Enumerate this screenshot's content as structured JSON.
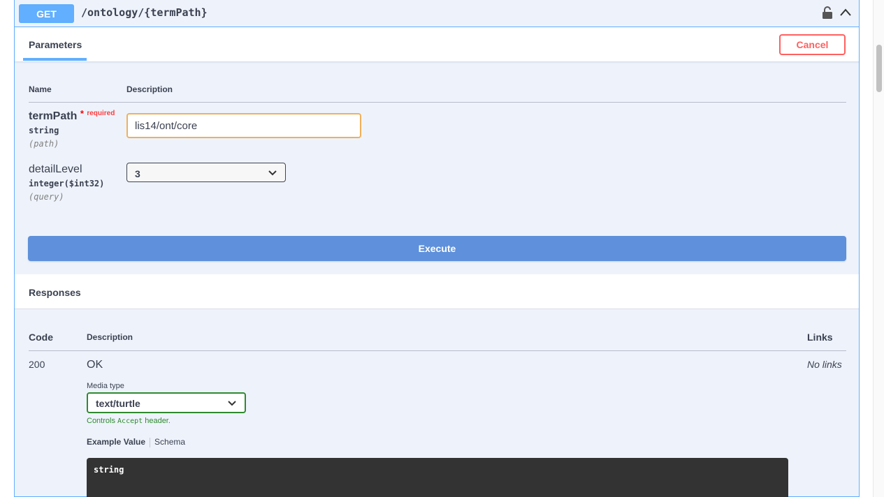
{
  "operation": {
    "method": "GET",
    "path": "/ontology/{termPath}"
  },
  "tabs": {
    "parameters_label": "Parameters",
    "cancel_label": "Cancel"
  },
  "parameters_table": {
    "header_name": "Name",
    "header_description": "Description",
    "params": [
      {
        "name": "termPath",
        "required_star": "*",
        "required_label": "required",
        "type": "string",
        "in": "(path)",
        "value": "lis14/ont/core"
      },
      {
        "name": "detailLevel",
        "type": "integer($int32)",
        "in": "(query)",
        "value": "3"
      }
    ]
  },
  "execute_label": "Execute",
  "responses": {
    "title": "Responses",
    "header_code": "Code",
    "header_description": "Description",
    "header_links": "Links",
    "rows": [
      {
        "code": "200",
        "description": "OK",
        "media_type_label": "Media type",
        "media_type_value": "text/turtle",
        "controls_prefix": "Controls",
        "controls_code": "Accept",
        "controls_suffix": "header.",
        "example_tab": "Example Value",
        "schema_tab": "Schema",
        "example": "string",
        "links": "No links"
      }
    ]
  },
  "colors": {
    "get_accent": "#61affe",
    "opblock_bg": "#eef3fb",
    "execute_bg": "#5e90db",
    "cancel": "#ff6060",
    "input_border": "#f0b05c",
    "media_border": "#2f8a2f"
  },
  "icons": [
    "lock-icon",
    "chevron-up-icon",
    "chevron-down-icon"
  ]
}
